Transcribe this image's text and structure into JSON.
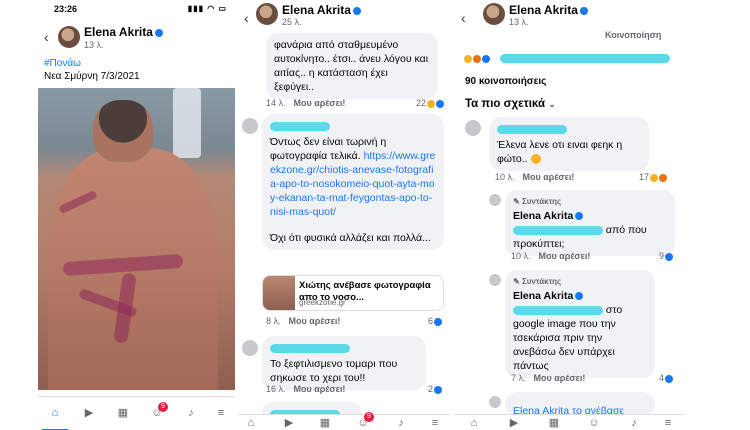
{
  "panel1": {
    "status_time": "23:26",
    "author": "Elena Akrita",
    "time": "13 λ.",
    "hashtag": "#Πονάω",
    "caption": "Νεα Σμύρνη 7/3/2021",
    "tab_badge": "9"
  },
  "panel2": {
    "author": "Elena Akrita",
    "time": "25 λ.",
    "comments": [
      {
        "text": "φανάρια από σταθμευμένο αυτοκίνητο.. έτσι.. άνευ λόγου και αιτίας.. η κατάσταση έχει ξεφύγει..",
        "time": "14 λ.",
        "like": "Μου αρέσει!",
        "count": "22"
      },
      {
        "text1": "Όντως δεν είναι τωρινή η φωτογραφία τελικά.",
        "link": "https://www.greekzone.gr/chiotis-anevase-fotografia-apo-to-nosokomeio-quot-ayta-moy-ekanan-ta-mat-feygontas-apo-to-nisi-mas-quot/",
        "text2": "Όχι ότι φυσικά αλλάζει και πολλά...",
        "preview_title": "Χιώτης ανέβασε φωτογραφία απο το νοσο...",
        "preview_domain": "greekzone.gr",
        "time": "8 λ.",
        "like": "Μου αρέσει!",
        "count": "6"
      },
      {
        "text": "Το ξεφτιλισμενο τομαρι που σηκωσε το χερι του!!",
        "time": "16 λ.",
        "like": "Μου αρέσει!",
        "count": "2"
      }
    ],
    "tab_badge": "9"
  },
  "panel3": {
    "author": "Elena Akrita",
    "time": "13 λ.",
    "top_partial": "Κοινοποίηση",
    "shares": "90 κοινοποιήσεις",
    "section": "Τα πιο σχετικά",
    "comments": [
      {
        "text": "Έλενα λενε οτι ειναι φεηκ η φώτο..",
        "time": "10 λ.",
        "like": "Μου αρέσει!",
        "count": "17"
      },
      {
        "tag": "Συντάκτης",
        "name": "Elena Akrita",
        "text_end": "από που",
        "text2": "προκύπτει;",
        "time": "10 λ.",
        "like": "Μου αρέσει!",
        "count": "9"
      },
      {
        "tag": "Συντάκτης",
        "name": "Elena Akrita",
        "text_end": "στο",
        "text2": "google image που την τσεκάρισα πριν την ανεβάσω δεν υπάρχει πάντως",
        "time": "7 λ.",
        "like": "Μου αρέσει!",
        "count": "4"
      },
      {
        "partial": "Elena Akrita το ανέβασε"
      }
    ]
  },
  "colors": {
    "accent": "#1877f2",
    "bubble": "#f0f2f5",
    "redaction": "#5ad9e8",
    "badge": "#e41e3f"
  }
}
